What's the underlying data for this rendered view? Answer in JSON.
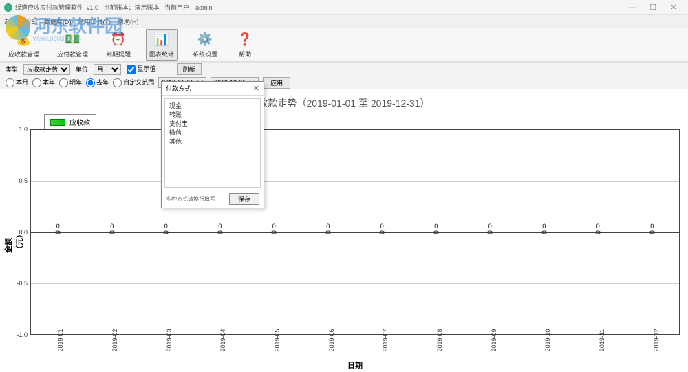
{
  "titlebar": {
    "app_name": "绿道应收应付款管理软件",
    "version": "v1.0",
    "db_label": "当前账本：演示账本",
    "user_label": "当前用户：admin"
  },
  "menubar": {
    "items": [
      "系统管理(S)",
      "数据库(D)",
      "常用工具(T)",
      "帮助(H)"
    ]
  },
  "toolbar": {
    "items": [
      {
        "label": "应收款管理",
        "icon": "💰"
      },
      {
        "label": "应付款管理",
        "icon": "💵"
      },
      {
        "label": "到期提醒",
        "icon": "⏰"
      },
      {
        "label": "图表统计",
        "icon": "📊",
        "active": true
      },
      {
        "label": "系统设置",
        "icon": "⚙️"
      },
      {
        "label": "帮助",
        "icon": "❓"
      }
    ]
  },
  "filters": {
    "type_label": "类型",
    "type_value": "应收款走势",
    "unit_label": "单位",
    "unit_value": "月",
    "show_value_label": "显示值",
    "refresh": "刷新",
    "range_this_month": "本月",
    "range_this_year": "本年",
    "range_next_year": "明年",
    "range_last_year": "去年",
    "range_custom": "自定义范围",
    "date_from": "2019-01-01",
    "date_to": "2019-12-31",
    "apply": "应用"
  },
  "chart_data": {
    "type": "line",
    "title": "收款走势（2019-01-01 至 2019-12-31）",
    "legend": "应收款",
    "xlabel": "日期",
    "ylabel": "金额（元）",
    "ylim": [
      -1.0,
      1.0
    ],
    "yticks": [
      -1.0,
      -0.5,
      0.0,
      0.5,
      1.0
    ],
    "categories": [
      "2019-01",
      "2019-02",
      "2019-03",
      "2019-04",
      "2019-05",
      "2019-06",
      "2019-07",
      "2019-08",
      "2019-09",
      "2019-10",
      "2019-11",
      "2019-12"
    ],
    "values": [
      0,
      0,
      0,
      0,
      0,
      0,
      0,
      0,
      0,
      0,
      0,
      0
    ],
    "value_labels": [
      "0",
      "0",
      "0",
      "0",
      "0",
      "0",
      "0",
      "0",
      "0",
      "0",
      "0",
      "0"
    ]
  },
  "dialog": {
    "title": "付款方式",
    "options": [
      "现金",
      "转账",
      "支付宝",
      "微信",
      "其他"
    ],
    "hint": "多种方式请换行填写",
    "save": "保存"
  },
  "watermark": {
    "text": "河东软件园",
    "url": "www.pc0359.cn"
  }
}
